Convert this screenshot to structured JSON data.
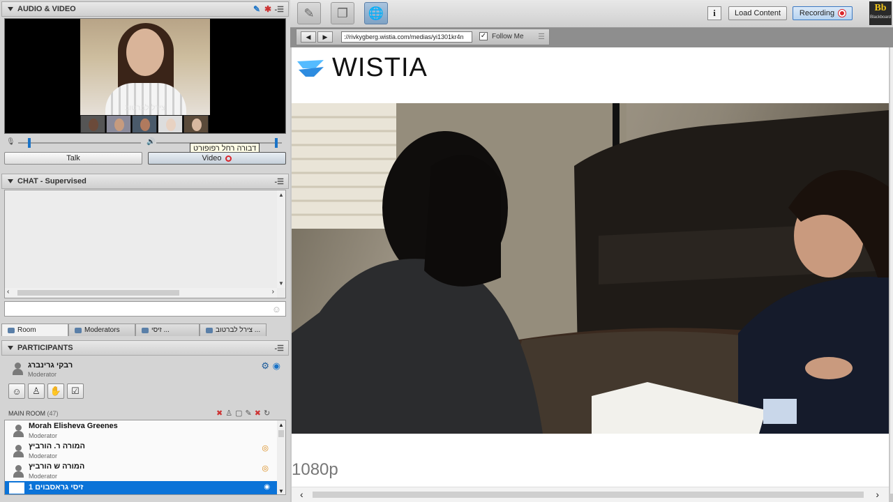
{
  "audio_video": {
    "title": "AUDIO & VIDEO",
    "speaker_name": "צירל לברטוב",
    "tooltip": "דבורה רחל רפופורט",
    "talk_label": "Talk",
    "video_label": "Video"
  },
  "chat": {
    "title": "CHAT - Supervised",
    "tabs": [
      {
        "label": "Room"
      },
      {
        "label": "Moderators"
      },
      {
        "label": "זיסי ..."
      },
      {
        "label": "צירל לברטוב ..."
      }
    ]
  },
  "participants": {
    "title": "PARTICIPANTS",
    "me": {
      "name": "רבקי גרינברג",
      "role": "Moderator"
    },
    "room_label": "MAIN ROOM",
    "room_count": "(47)",
    "list": [
      {
        "name": "Morah Elisheva Greenes",
        "role": "Moderator"
      },
      {
        "name": "המורה ר. הורביץ",
        "role": "Moderator"
      },
      {
        "name": "המורה ש הורביץ",
        "role": "Moderator"
      },
      {
        "name": "זיסי גראסבוים 1",
        "role": ""
      }
    ]
  },
  "toolbar": {
    "load_content": "Load Content",
    "recording": "Recording",
    "bb_logo": "Bb",
    "bb_caption": "Blackboard"
  },
  "browser": {
    "url": "://rivkygberg.wistia.com/medias/yi1301kr4n",
    "follow_me": "Follow Me"
  },
  "page": {
    "brand": "WISTIA",
    "resolution": "1080p"
  },
  "colors": {
    "accent": "#0b73d8",
    "wistia_blue": "#2d8ce0",
    "record_red": "#d9252b"
  }
}
